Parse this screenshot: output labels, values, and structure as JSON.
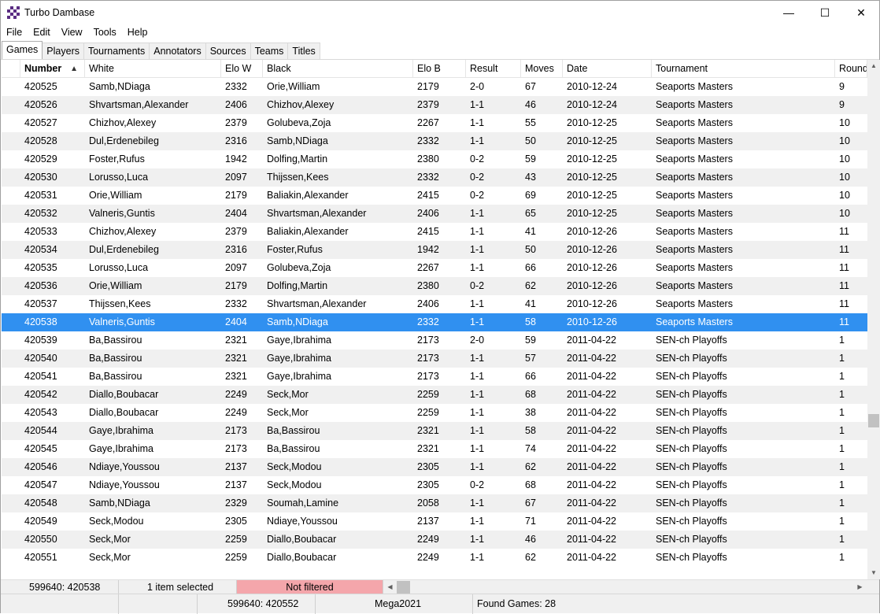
{
  "window": {
    "title": "Turbo Dambase",
    "controls": {
      "minimize": "—",
      "maximize": "☐",
      "close": "✕"
    }
  },
  "menu": [
    "File",
    "Edit",
    "View",
    "Tools",
    "Help"
  ],
  "tabs": [
    "Games",
    "Players",
    "Tournaments",
    "Annotators",
    "Sources",
    "Teams",
    "Titles"
  ],
  "active_tab": "Games",
  "grid": {
    "columns": [
      "",
      "Number",
      "White",
      "Elo W",
      "Black",
      "Elo B",
      "Result",
      "Moves",
      "Date",
      "Tournament",
      "Round"
    ],
    "sorted_column": "Number",
    "sort_direction": "ascending",
    "selected_row": "420538",
    "rows": [
      [
        "420525",
        "Samb,NDiaga",
        "2332",
        "Orie,William",
        "2179",
        "2-0",
        "67",
        "2010-12-24",
        "Seaports Masters",
        "9"
      ],
      [
        "420526",
        "Shvartsman,Alexander",
        "2406",
        "Chizhov,Alexey",
        "2379",
        "1-1",
        "46",
        "2010-12-24",
        "Seaports Masters",
        "9"
      ],
      [
        "420527",
        "Chizhov,Alexey",
        "2379",
        "Golubeva,Zoja",
        "2267",
        "1-1",
        "55",
        "2010-12-25",
        "Seaports Masters",
        "10"
      ],
      [
        "420528",
        "Dul,Erdenebileg",
        "2316",
        "Samb,NDiaga",
        "2332",
        "1-1",
        "50",
        "2010-12-25",
        "Seaports Masters",
        "10"
      ],
      [
        "420529",
        "Foster,Rufus",
        "1942",
        "Dolfing,Martin",
        "2380",
        "0-2",
        "59",
        "2010-12-25",
        "Seaports Masters",
        "10"
      ],
      [
        "420530",
        "Lorusso,Luca",
        "2097",
        "Thijssen,Kees",
        "2332",
        "0-2",
        "43",
        "2010-12-25",
        "Seaports Masters",
        "10"
      ],
      [
        "420531",
        "Orie,William",
        "2179",
        "Baliakin,Alexander",
        "2415",
        "0-2",
        "69",
        "2010-12-25",
        "Seaports Masters",
        "10"
      ],
      [
        "420532",
        "Valneris,Guntis",
        "2404",
        "Shvartsman,Alexander",
        "2406",
        "1-1",
        "65",
        "2010-12-25",
        "Seaports Masters",
        "10"
      ],
      [
        "420533",
        "Chizhov,Alexey",
        "2379",
        "Baliakin,Alexander",
        "2415",
        "1-1",
        "41",
        "2010-12-26",
        "Seaports Masters",
        "11"
      ],
      [
        "420534",
        "Dul,Erdenebileg",
        "2316",
        "Foster,Rufus",
        "1942",
        "1-1",
        "50",
        "2010-12-26",
        "Seaports Masters",
        "11"
      ],
      [
        "420535",
        "Lorusso,Luca",
        "2097",
        "Golubeva,Zoja",
        "2267",
        "1-1",
        "66",
        "2010-12-26",
        "Seaports Masters",
        "11"
      ],
      [
        "420536",
        "Orie,William",
        "2179",
        "Dolfing,Martin",
        "2380",
        "0-2",
        "62",
        "2010-12-26",
        "Seaports Masters",
        "11"
      ],
      [
        "420537",
        "Thijssen,Kees",
        "2332",
        "Shvartsman,Alexander",
        "2406",
        "1-1",
        "41",
        "2010-12-26",
        "Seaports Masters",
        "11"
      ],
      [
        "420538",
        "Valneris,Guntis",
        "2404",
        "Samb,NDiaga",
        "2332",
        "1-1",
        "58",
        "2010-12-26",
        "Seaports Masters",
        "11"
      ],
      [
        "420539",
        "Ba,Bassirou",
        "2321",
        "Gaye,Ibrahima",
        "2173",
        "2-0",
        "59",
        "2011-04-22",
        "SEN-ch Playoffs",
        "1"
      ],
      [
        "420540",
        "Ba,Bassirou",
        "2321",
        "Gaye,Ibrahima",
        "2173",
        "1-1",
        "57",
        "2011-04-22",
        "SEN-ch Playoffs",
        "1"
      ],
      [
        "420541",
        "Ba,Bassirou",
        "2321",
        "Gaye,Ibrahima",
        "2173",
        "1-1",
        "66",
        "2011-04-22",
        "SEN-ch Playoffs",
        "1"
      ],
      [
        "420542",
        "Diallo,Boubacar",
        "2249",
        "Seck,Mor",
        "2259",
        "1-1",
        "68",
        "2011-04-22",
        "SEN-ch Playoffs",
        "1"
      ],
      [
        "420543",
        "Diallo,Boubacar",
        "2249",
        "Seck,Mor",
        "2259",
        "1-1",
        "38",
        "2011-04-22",
        "SEN-ch Playoffs",
        "1"
      ],
      [
        "420544",
        "Gaye,Ibrahima",
        "2173",
        "Ba,Bassirou",
        "2321",
        "1-1",
        "58",
        "2011-04-22",
        "SEN-ch Playoffs",
        "1"
      ],
      [
        "420545",
        "Gaye,Ibrahima",
        "2173",
        "Ba,Bassirou",
        "2321",
        "1-1",
        "74",
        "2011-04-22",
        "SEN-ch Playoffs",
        "1"
      ],
      [
        "420546",
        "Ndiaye,Youssou",
        "2137",
        "Seck,Modou",
        "2305",
        "1-1",
        "62",
        "2011-04-22",
        "SEN-ch Playoffs",
        "1"
      ],
      [
        "420547",
        "Ndiaye,Youssou",
        "2137",
        "Seck,Modou",
        "2305",
        "0-2",
        "68",
        "2011-04-22",
        "SEN-ch Playoffs",
        "1"
      ],
      [
        "420548",
        "Samb,NDiaga",
        "2329",
        "Soumah,Lamine",
        "2058",
        "1-1",
        "67",
        "2011-04-22",
        "SEN-ch Playoffs",
        "1"
      ],
      [
        "420549",
        "Seck,Modou",
        "2305",
        "Ndiaye,Youssou",
        "2137",
        "1-1",
        "71",
        "2011-04-22",
        "SEN-ch Playoffs",
        "1"
      ],
      [
        "420550",
        "Seck,Mor",
        "2259",
        "Diallo,Boubacar",
        "2249",
        "1-1",
        "46",
        "2011-04-22",
        "SEN-ch Playoffs",
        "1"
      ],
      [
        "420551",
        "Seck,Mor",
        "2259",
        "Diallo,Boubacar",
        "2249",
        "1-1",
        "62",
        "2011-04-22",
        "SEN-ch Playoffs",
        "1"
      ]
    ]
  },
  "status_bar_top": {
    "position": "599640: 420538",
    "selection": "1 item selected",
    "filter": "Not filtered"
  },
  "status_bar_bottom": {
    "position": "599640: 420552",
    "database": "Mega2021",
    "found": "Found Games: 28"
  },
  "icons": {
    "app": "checkerboard-icon",
    "sort": "sort-ascending-icon",
    "scroll_up": "▲",
    "scroll_down": "▼",
    "scroll_left": "◀",
    "scroll_right": "▶"
  },
  "colors": {
    "selection": "#3090f0",
    "alt_row": "#f0f0f0",
    "not_filtered_bg": "#f4a6ab",
    "app_icon": "#5a2d82"
  }
}
